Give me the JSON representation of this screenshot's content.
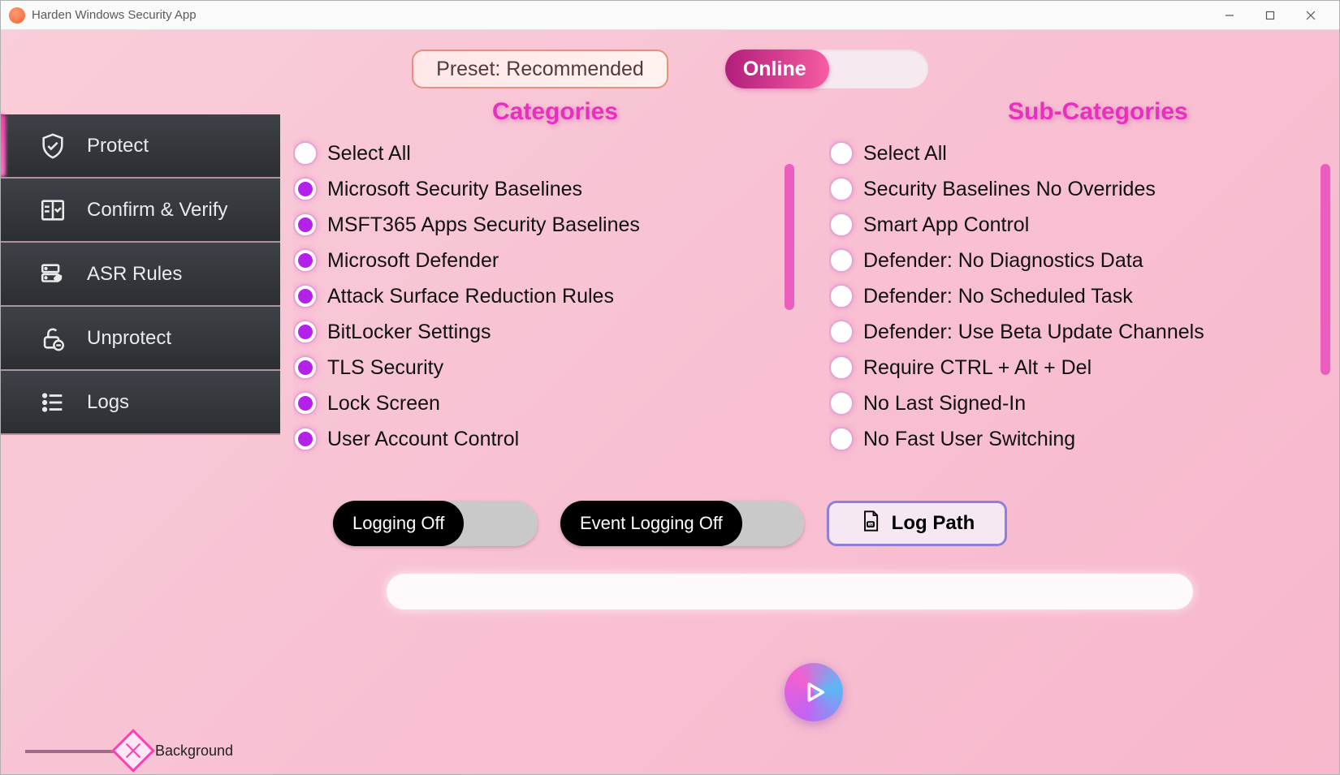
{
  "window": {
    "title": "Harden Windows Security App"
  },
  "top": {
    "preset_label": "Preset: Recommended",
    "online_label": "Online"
  },
  "sidebar": {
    "items": [
      {
        "label": "Protect",
        "icon": "shield-check-icon",
        "active": true
      },
      {
        "label": "Confirm & Verify",
        "icon": "book-check-icon",
        "active": false
      },
      {
        "label": "ASR Rules",
        "icon": "server-shield-icon",
        "active": false
      },
      {
        "label": "Unprotect",
        "icon": "unlock-minus-icon",
        "active": false
      },
      {
        "label": "Logs",
        "icon": "list-icon",
        "active": false
      }
    ]
  },
  "headings": {
    "categories": "Categories",
    "subcategories": "Sub-Categories"
  },
  "categories": [
    {
      "label": "Select All",
      "selected": false
    },
    {
      "label": "Microsoft Security Baselines",
      "selected": true
    },
    {
      "label": "MSFT365 Apps Security Baselines",
      "selected": true
    },
    {
      "label": "Microsoft Defender",
      "selected": true
    },
    {
      "label": "Attack Surface Reduction Rules",
      "selected": true
    },
    {
      "label": "BitLocker Settings",
      "selected": true
    },
    {
      "label": "TLS Security",
      "selected": true
    },
    {
      "label": "Lock Screen",
      "selected": true
    },
    {
      "label": "User Account Control",
      "selected": true
    }
  ],
  "subcategories": [
    {
      "label": "Select All",
      "selected": false
    },
    {
      "label": "Security Baselines No Overrides",
      "selected": false
    },
    {
      "label": "Smart App Control",
      "selected": false
    },
    {
      "label": "Defender: No Diagnostics Data",
      "selected": false
    },
    {
      "label": "Defender: No Scheduled Task",
      "selected": false
    },
    {
      "label": "Defender: Use Beta Update Channels",
      "selected": false
    },
    {
      "label": "Require CTRL + Alt + Del",
      "selected": false
    },
    {
      "label": "No Last Signed-In",
      "selected": false
    },
    {
      "label": "No Fast User Switching",
      "selected": false
    }
  ],
  "controls": {
    "logging_label": "Logging Off",
    "event_logging_label": "Event Logging Off",
    "log_path_label": "Log Path",
    "background_label": "Background"
  }
}
